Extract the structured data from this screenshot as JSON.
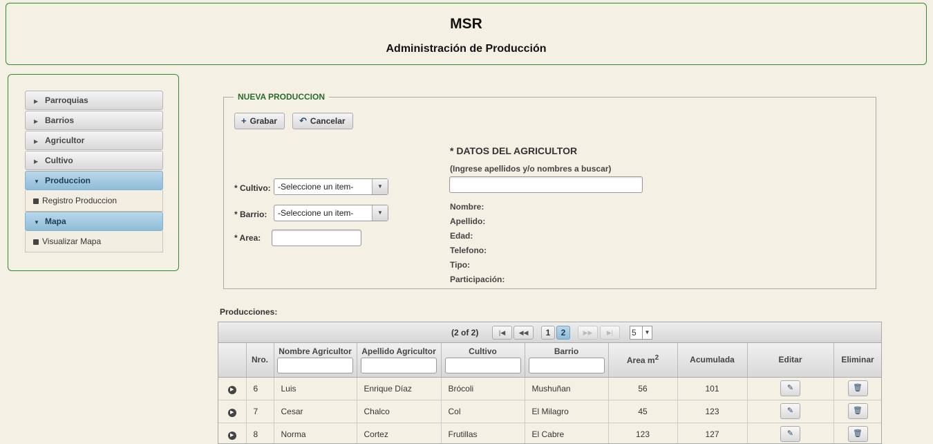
{
  "header": {
    "title": "MSR",
    "subtitle": "Administración de Producción"
  },
  "sidebar": {
    "items": [
      {
        "label": "Parroquias"
      },
      {
        "label": "Barrios"
      },
      {
        "label": "Agricultor"
      },
      {
        "label": "Cultivo"
      },
      {
        "label": "Produccion",
        "sub": "Registro Produccion"
      },
      {
        "label": "Mapa",
        "sub": "Visualizar Mapa"
      }
    ]
  },
  "form": {
    "legend": "NUEVA PRODUCCION",
    "save_label": "Grabar",
    "cancel_label": "Cancelar",
    "cultivo_label": "* Cultivo:",
    "cultivo_value": "-Seleccione un item-",
    "barrio_label": "* Barrio:",
    "barrio_value": "-Seleccione un item-",
    "area_label": "* Area:",
    "farmer_title": "* DATOS DEL AGRICULTOR",
    "farmer_hint": "(Ingrese apellidos y/o nombres a buscar)",
    "farmer_fields": [
      "Nombre:",
      "Apellido:",
      "Edad:",
      "Telefono:",
      "Tipo:",
      "Participación:"
    ]
  },
  "table": {
    "label": "Producciones:",
    "paginator": {
      "text": "(2 of 2)",
      "pages": [
        "1",
        "2"
      ],
      "rows_per_page": "5"
    },
    "columns": [
      "Nro.",
      "Nombre Agricultor",
      "Apellido Agricultor",
      "Cultivo",
      "Barrio",
      "Area m",
      "Acumulada",
      "Editar",
      "Eliminar"
    ],
    "area_sup": "2",
    "rows": [
      {
        "nro": "6",
        "nombre": "Luis",
        "apellido": "Enrique Díaz",
        "cultivo": "Brócoli",
        "barrio": "Mushuñan",
        "area": "56",
        "acumulada": "101"
      },
      {
        "nro": "7",
        "nombre": "Cesar",
        "apellido": "Chalco",
        "cultivo": "Col",
        "barrio": "El Milagro",
        "area": "45",
        "acumulada": "123"
      },
      {
        "nro": "8",
        "nombre": "Norma",
        "apellido": "Cortez",
        "cultivo": "Frutillas",
        "barrio": "El Cabre",
        "area": "123",
        "acumulada": "127"
      }
    ]
  }
}
